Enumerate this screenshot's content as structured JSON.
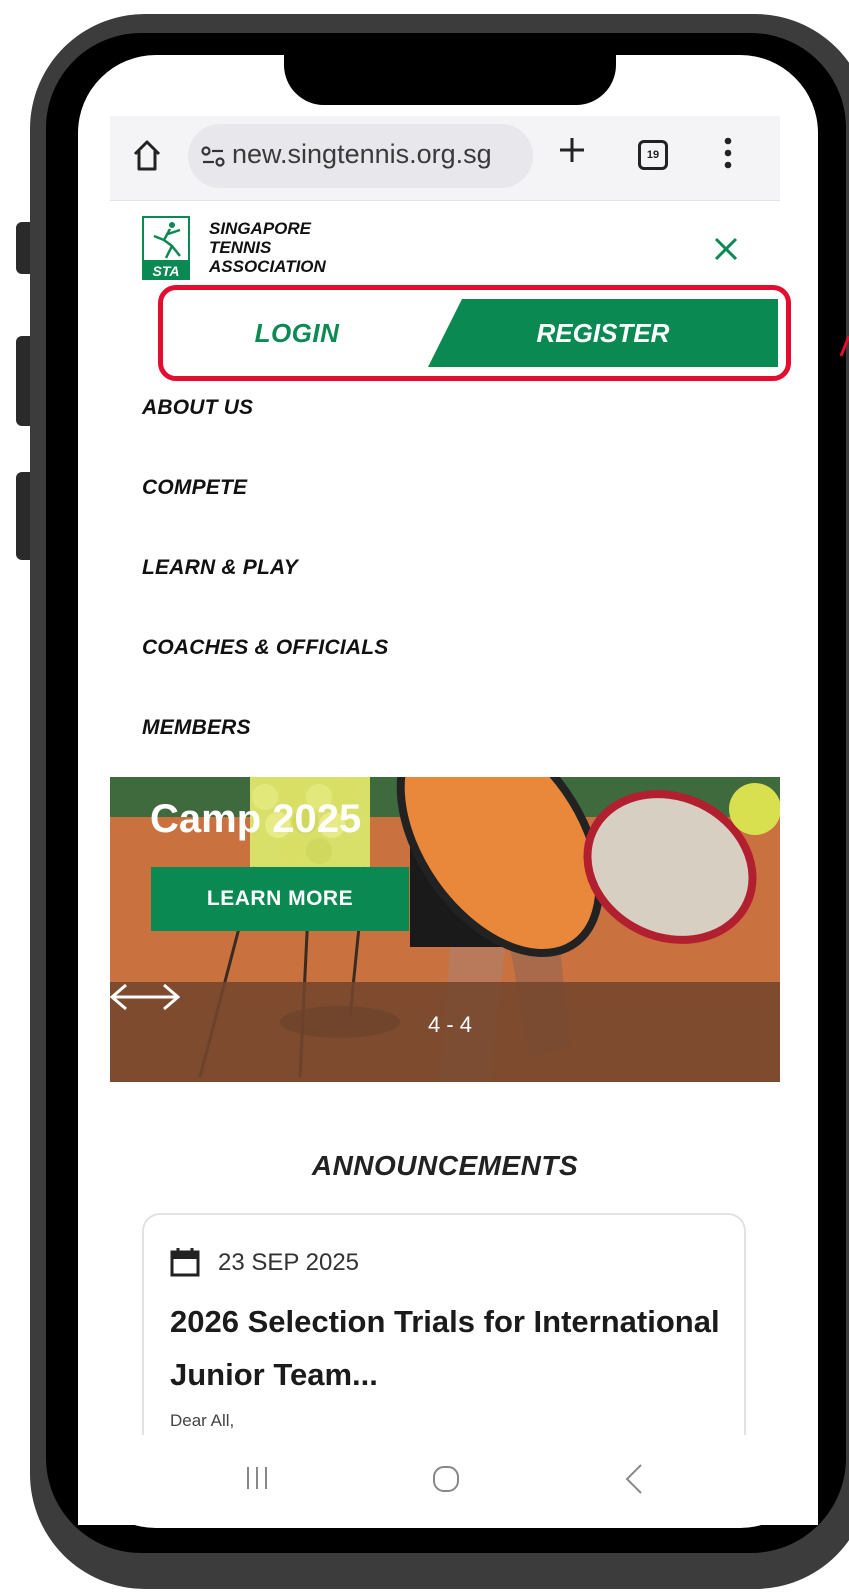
{
  "browser": {
    "url": "new.singtennis.org.sg",
    "tab_count": "19"
  },
  "site": {
    "logo_mark": "STA",
    "logo_lines": [
      "SINGAPORE",
      "TENNIS",
      "ASSOCIATION"
    ]
  },
  "auth": {
    "login_label": "LOGIN",
    "register_label": "REGISTER"
  },
  "nav": {
    "items": [
      "ABOUT US",
      "COMPETE",
      "LEARN & PLAY",
      "COACHES & OFFICIALS",
      "MEMBERS"
    ]
  },
  "banner": {
    "title": "Camp 2025",
    "cta_label": "LEARN MORE",
    "slide_indicator": "4 - 4"
  },
  "announcements": {
    "heading": "ANNOUNCEMENTS",
    "card": {
      "date": "23 SEP 2025",
      "title": "2026 Selection Trials for International Junior Team...",
      "excerpt": "Dear All,"
    }
  },
  "colors": {
    "brand_green": "#0a8a52",
    "highlight_red": "#e30d2f"
  }
}
